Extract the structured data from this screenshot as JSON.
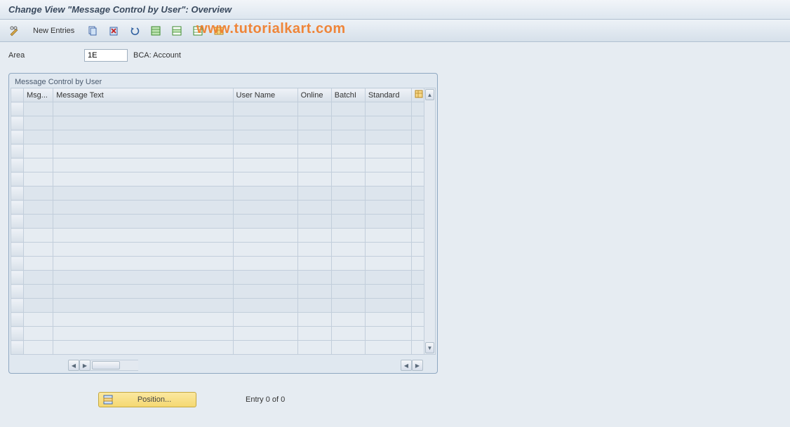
{
  "title": "Change View \"Message Control by User\": Overview",
  "toolbar": {
    "new_entries": "New Entries"
  },
  "watermark": "www.tutorialkart.com",
  "field": {
    "area_label": "Area",
    "area_value": "1E",
    "area_desc": "BCA: Account"
  },
  "panel": {
    "title": "Message Control by User",
    "columns": {
      "msg": "Msg...",
      "msg_text": "Message Text",
      "user_name": "User Name",
      "online": "Online",
      "batchi": "BatchI",
      "standard": "Standard"
    }
  },
  "footer": {
    "position_label": "Position...",
    "entry_text": "Entry 0 of 0"
  }
}
